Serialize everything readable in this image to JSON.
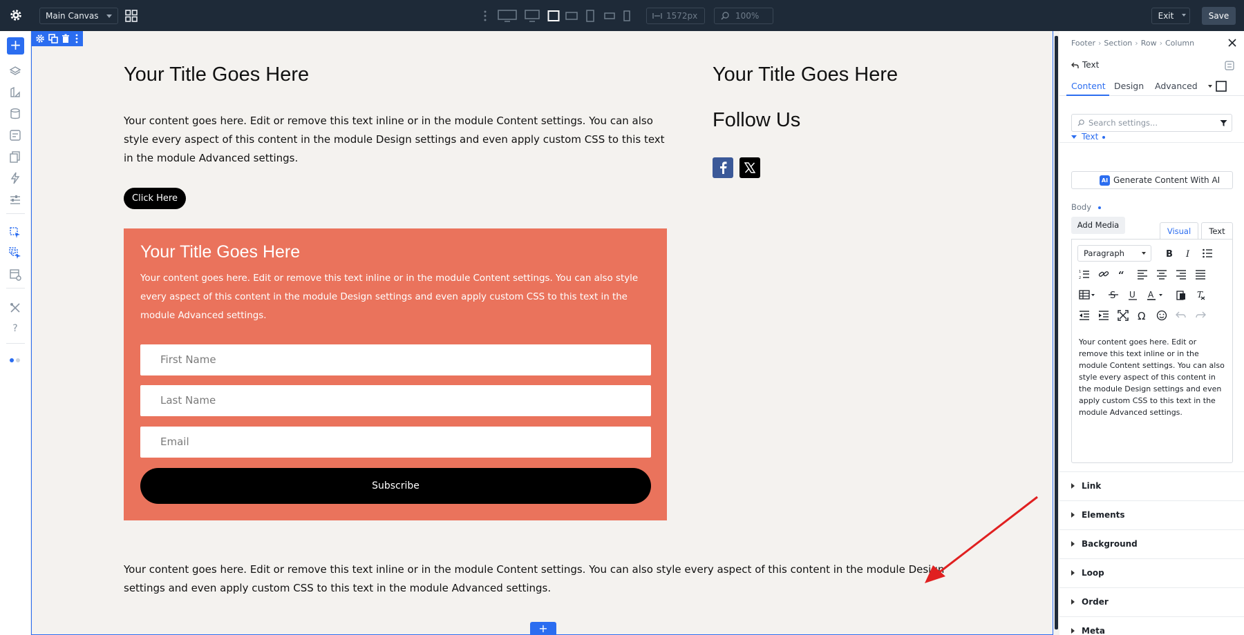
{
  "topbar": {
    "canvas_select": "Main Canvas",
    "width_value": "1572px",
    "zoom_value": "100%",
    "exit_label": "Exit",
    "save_label": "Save"
  },
  "canvas": {
    "left_title": "Your Title Goes Here",
    "left_text": "Your content goes here. Edit or remove this text inline or in the module Content settings. You can also style every aspect of this content in the module Design settings and even apply custom CSS to this text in the module Advanced settings.",
    "button_label": "Click Here",
    "right_title": "Your Title Goes Here",
    "follow_title": "Follow Us",
    "social": [
      "facebook-icon",
      "x-icon"
    ],
    "social_colors": {
      "facebook": "#3b5998",
      "x": "#000000"
    },
    "optin": {
      "bg_color": "#ea735c",
      "title": "Your Title Goes Here",
      "text": "Your content goes here. Edit or remove this text inline or in the module Content settings. You can also style every aspect of this content in the module Design settings and even apply custom CSS to this text in the module Advanced settings.",
      "fields": [
        "First Name",
        "Last Name",
        "Email"
      ],
      "subscribe_label": "Subscribe"
    },
    "bottom_text": "Your content goes here. Edit or remove this text inline or in the module Content settings. You can also style every aspect of this content in the module Design settings and even apply custom CSS to this text in the module Advanced settings."
  },
  "panel": {
    "breadcrumb": [
      "Footer",
      "Section",
      "Row",
      "Column"
    ],
    "module_name": "Text",
    "tabs": [
      "Content",
      "Design",
      "Advanced"
    ],
    "search_placeholder": "Search settings...",
    "text_section": "Text",
    "ai_button": "Generate Content With AI",
    "ai_badge": "AI",
    "body_label": "Body",
    "add_media": "Add Media",
    "editor_tabs": [
      "Visual",
      "Text"
    ],
    "paragraph_select": "Paragraph",
    "editor_content": "Your content goes here. Edit or remove this text inline or in the module Content settings. You can also style every aspect of this content in the module Design settings and even apply custom CSS to this text in the module Advanced settings.",
    "accordions": [
      "Link",
      "Elements",
      "Background",
      "Loop",
      "Order",
      "Meta"
    ],
    "accent_color": "#2b6df0"
  }
}
